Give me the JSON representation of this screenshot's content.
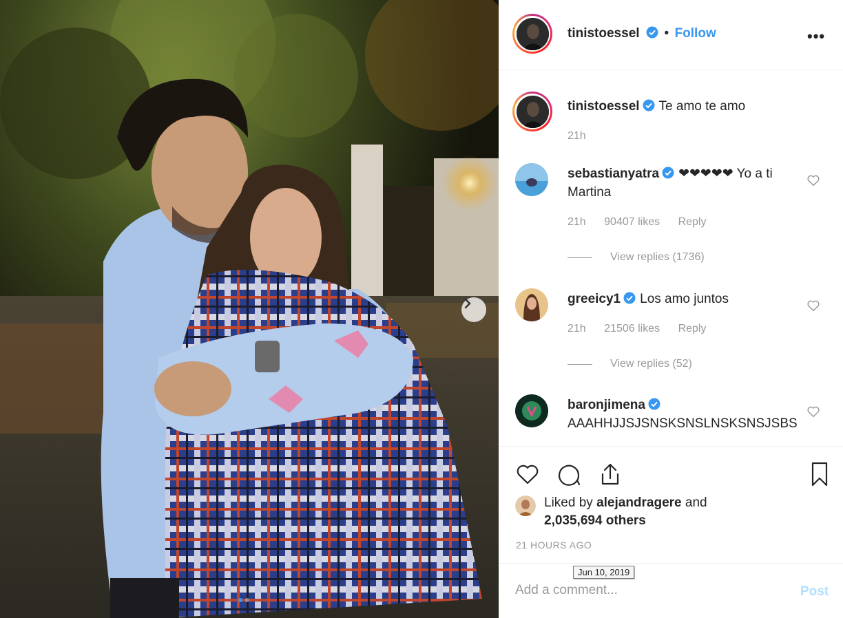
{
  "post": {
    "author": "tinistoessel",
    "follow_separator": "•",
    "follow_label": "Follow",
    "more_label": "•••",
    "caption": "Te amo te amo",
    "caption_time": "21h"
  },
  "comments": [
    {
      "username": "sebastianyatra",
      "text": "❤❤❤❤❤ Yo a ti Martina",
      "time": "21h",
      "likes": "90407 likes",
      "reply": "Reply",
      "view_replies": "View replies (1736)"
    },
    {
      "username": "greeicy1",
      "text": "Los amo juntos",
      "time": "21h",
      "likes": "21506 likes",
      "reply": "Reply",
      "view_replies": "View replies (52)"
    },
    {
      "username": "baronjimena",
      "text": "AAAHHJJSJSNSKSNSLNSKSNSJSBSKSNKKFSBSIDISNEIDKKKDISKSA"
    }
  ],
  "engagement": {
    "liked_by_prefix": "Liked by",
    "liked_by_user": "alejandragere",
    "liked_by_and": "and",
    "others": "2,035,694 others",
    "time_ago": "21 HOURS AGO",
    "tooltip_date": "Jun 10, 2019"
  },
  "comment_box": {
    "placeholder": "Add a comment...",
    "post_label": "Post"
  },
  "carousel": {
    "current_slide": 1,
    "total_slides": 2
  },
  "colors": {
    "accent": "#3897f0",
    "verified": "#3897f0",
    "muted": "#999999",
    "post_disabled": "#b2dffc"
  },
  "icons": [
    "more-options-icon",
    "next-arrow-icon",
    "verified-badge-icon",
    "heart-icon",
    "comment-icon",
    "share-icon",
    "bookmark-icon"
  ]
}
